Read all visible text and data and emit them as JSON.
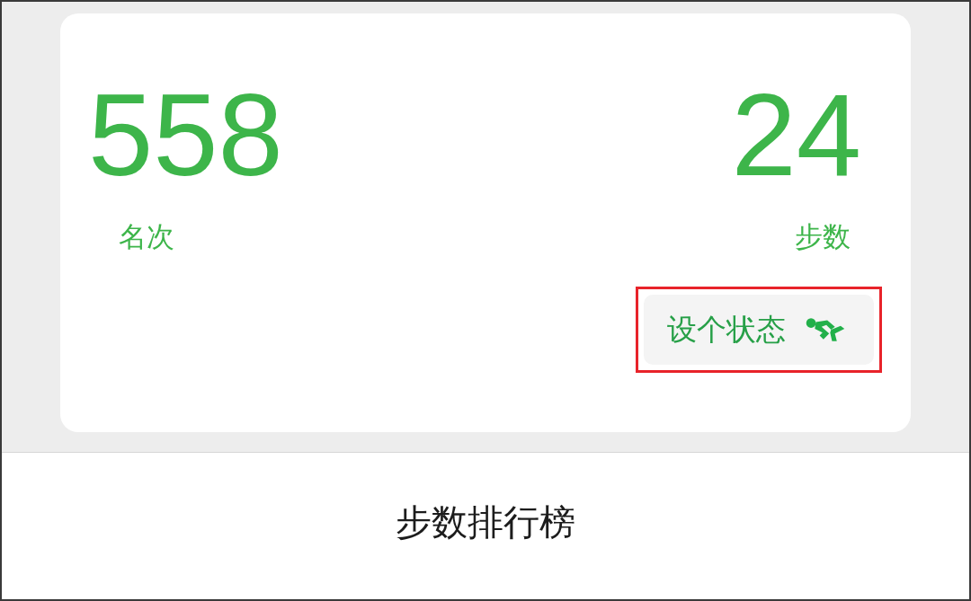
{
  "stats": [
    {
      "kind": "left",
      "value": "558",
      "label": "名次"
    },
    {
      "kind": "right",
      "value": "24",
      "label": "步数"
    }
  ],
  "status_button": {
    "label": "设个状态",
    "highlighted": true
  },
  "bottom_bar": {
    "title": "步数排行榜"
  }
}
